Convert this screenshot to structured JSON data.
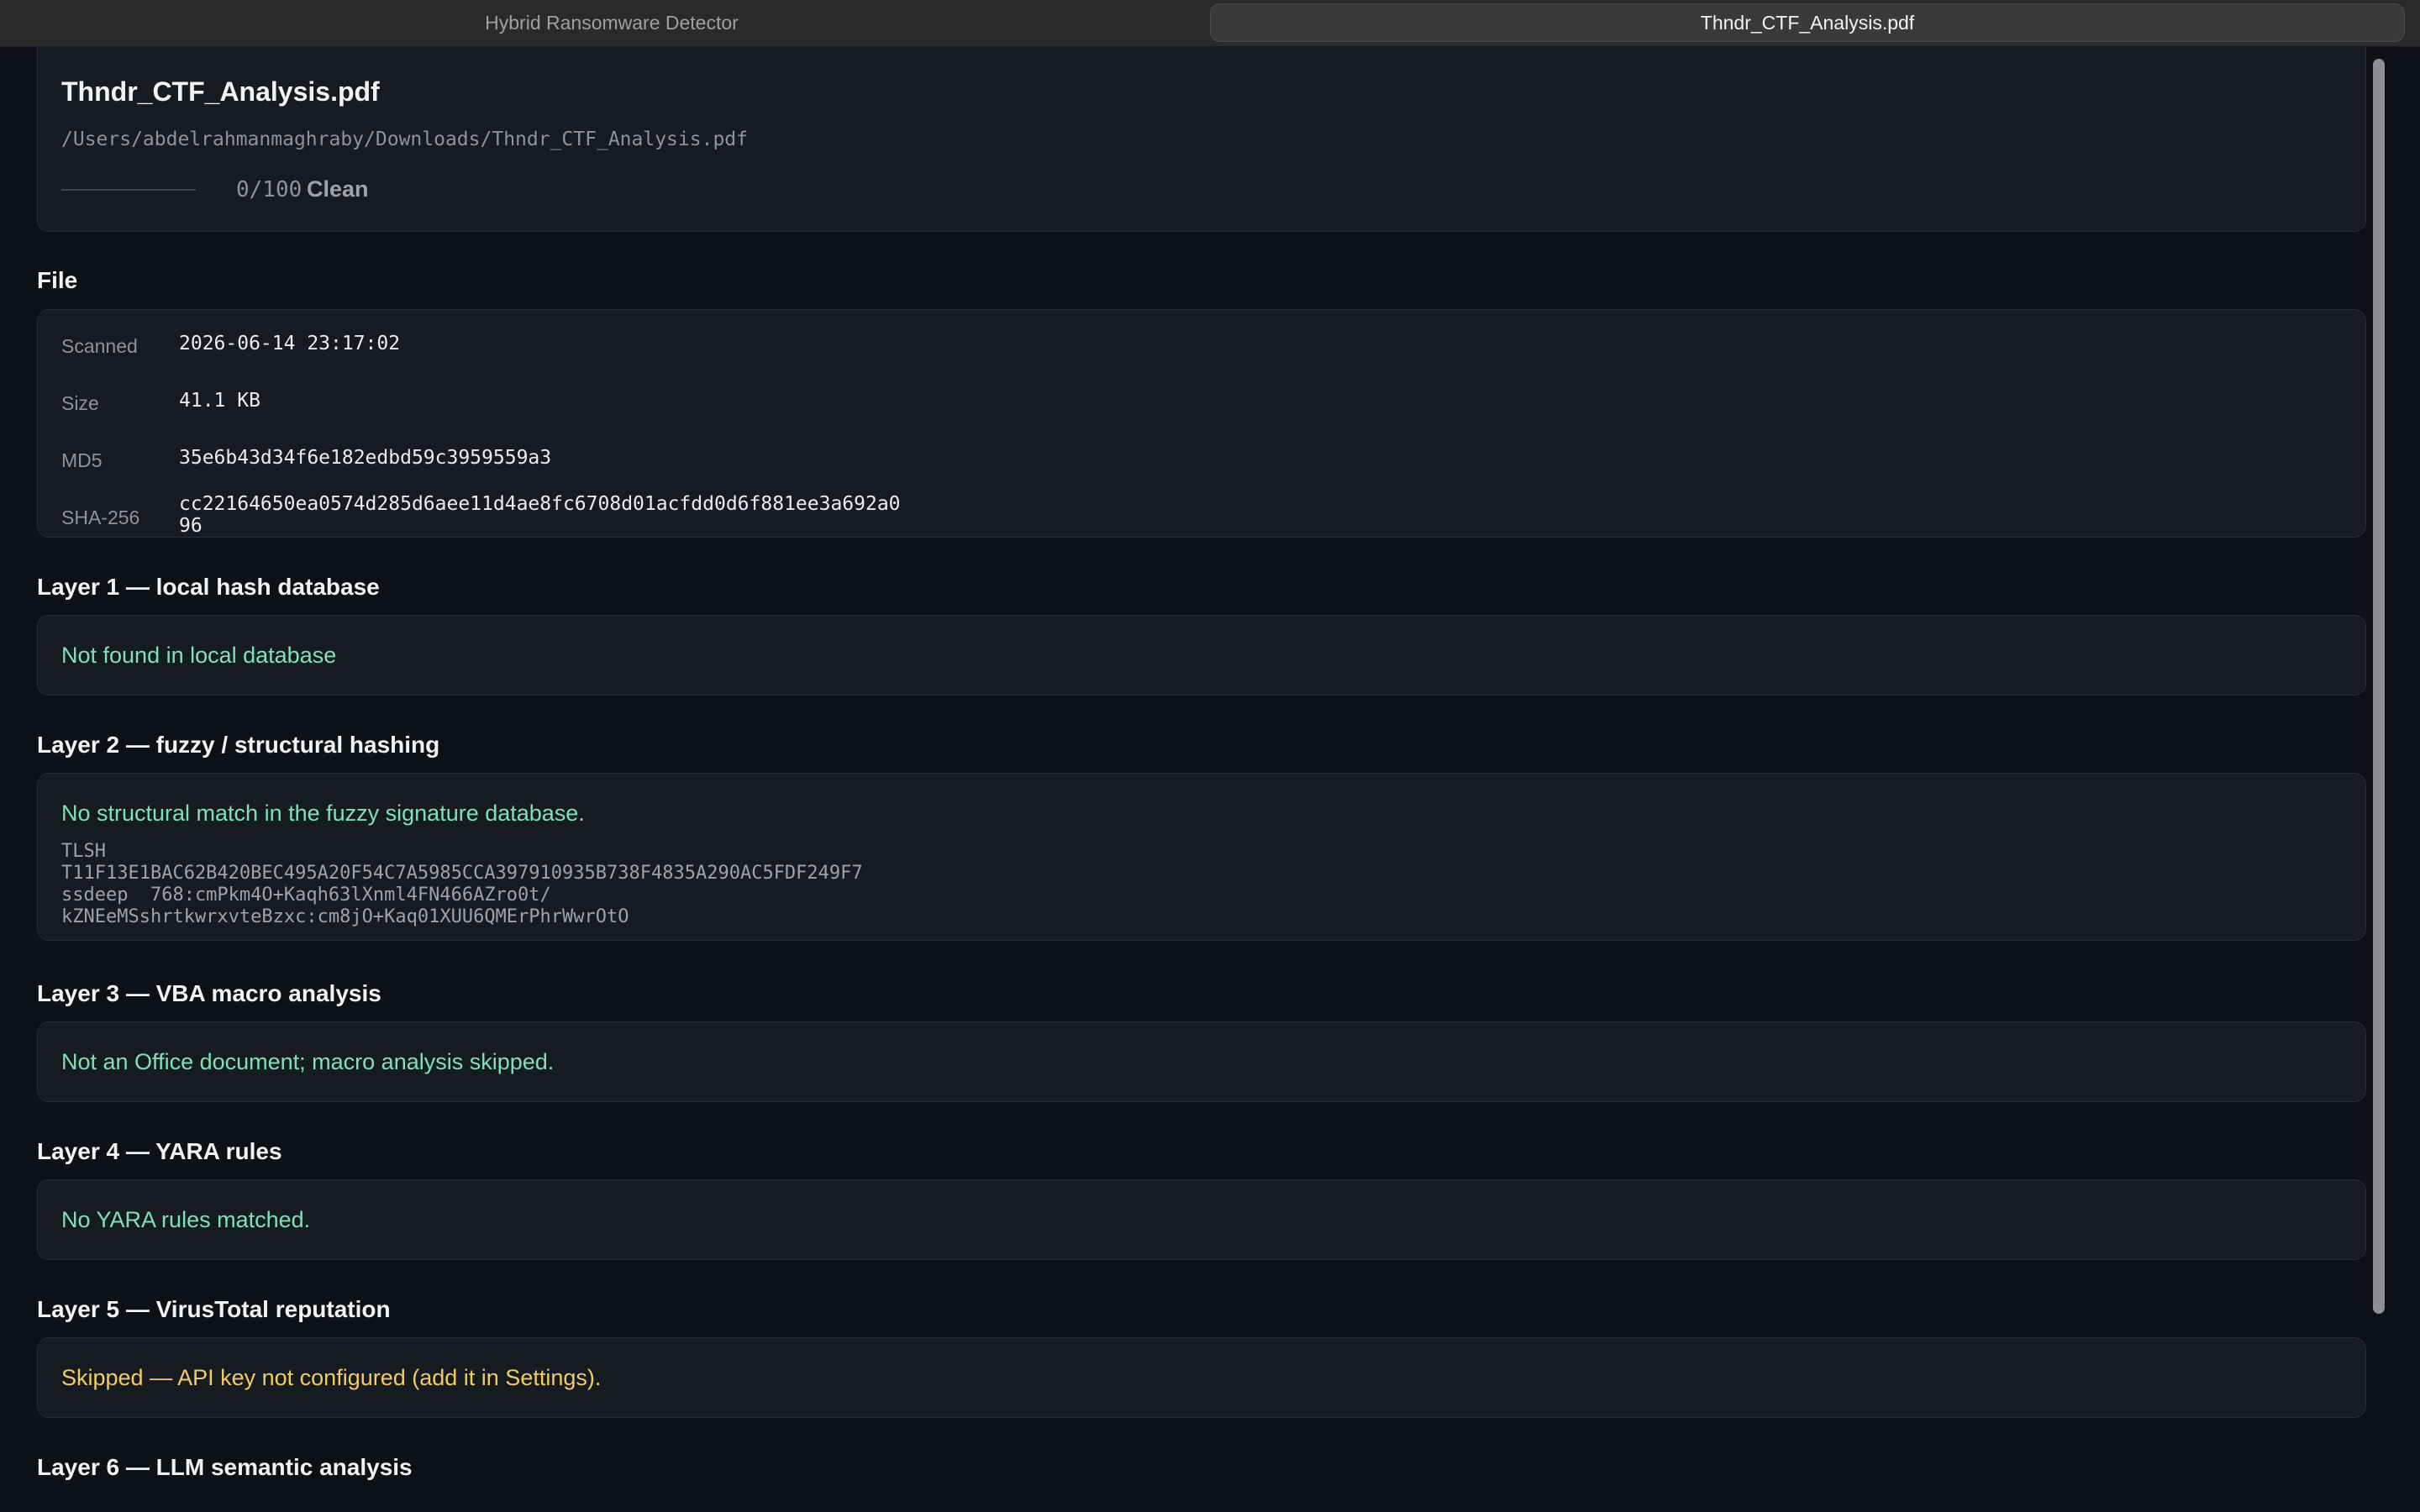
{
  "tabs": [
    {
      "label": "Hybrid Ransomware Detector",
      "active": false
    },
    {
      "label": "Thndr_CTF_Analysis.pdf",
      "active": true
    }
  ],
  "header": {
    "title": "Thndr_CTF_Analysis.pdf",
    "path": "/Users/abdelrahmanmaghraby/Downloads/Thndr_CTF_Analysis.pdf",
    "score": 0,
    "score_text": "0/100",
    "verdict": "Clean"
  },
  "file_section": {
    "title": "File",
    "rows": [
      {
        "label": "Scanned",
        "value": "2026-06-14 23:17:02"
      },
      {
        "label": "Size",
        "value": "41.1 KB"
      },
      {
        "label": "MD5",
        "value": "35e6b43d34f6e182edbd59c3959559a3"
      },
      {
        "label": "SHA-256",
        "value": "cc22164650ea0574d285d6aee11d4ae8fc6708d01acfdd0d6f881ee3a692a0",
        "value2": "96"
      }
    ]
  },
  "layers": {
    "l1": {
      "title": "Layer 1 — local hash database",
      "message": "Not found in local database"
    },
    "l2": {
      "title": "Layer 2 — fuzzy / structural hashing",
      "message": "No structural match in the fuzzy signature database.",
      "hash_lines": [
        "TLSH",
        "T11F13E1BAC62B420BEC495A20F54C7A5985CCA397910935B738F4835A290AC5FDF249F7",
        "ssdeep  768:cmPkm4O+Kaqh63lXnml4FN466AZro0t/",
        "kZNEeMSshrtkwrxvteBzxc:cm8jO+Kaq01XUU6QMErPhrWwrOtO"
      ]
    },
    "l3": {
      "title": "Layer 3 — VBA macro analysis",
      "message": "Not an Office document; macro analysis skipped."
    },
    "l4": {
      "title": "Layer 4 — YARA rules",
      "message": "No YARA rules matched."
    },
    "l5": {
      "title": "Layer 5 — VirusTotal reputation",
      "message": "Skipped — API key not configured (add it in Settings)."
    },
    "l6": {
      "title": "Layer 6 — LLM semantic analysis"
    }
  },
  "colors": {
    "ok": "#7ee2b8",
    "warn": "#f2cc60",
    "background": "#0d1117",
    "card": "#161b22"
  }
}
